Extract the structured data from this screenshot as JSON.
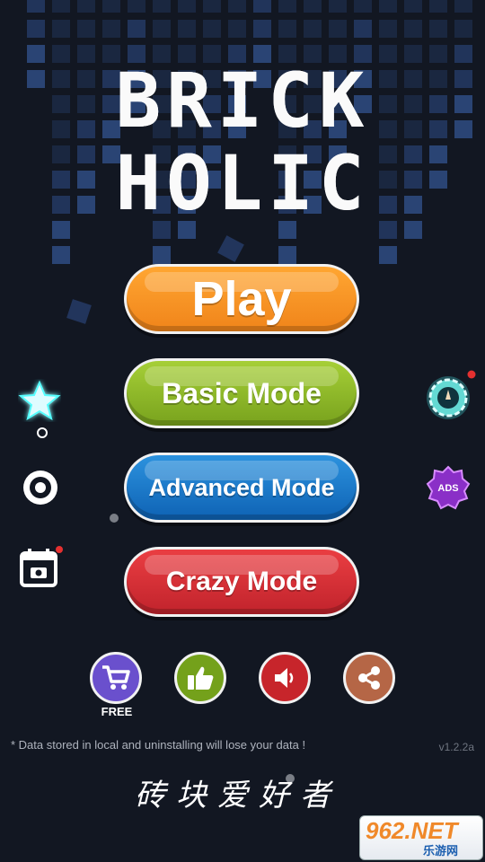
{
  "title": {
    "line1": "BRICK",
    "line2": "HOLIC"
  },
  "menu": {
    "play": "Play",
    "basic": "Basic Mode",
    "advanced": "Advanced Mode",
    "crazy": "Crazy Mode"
  },
  "side_icons": {
    "left": [
      "star-icon",
      "target-icon",
      "calendar-icon"
    ],
    "right": [
      "timer-gear-icon",
      "no-ads-icon"
    ],
    "no_ads_label": "ADS"
  },
  "bottom_buttons": {
    "shop_label": "FREE",
    "icons": [
      "cart-icon",
      "thumbs-up-icon",
      "speaker-icon",
      "share-icon"
    ]
  },
  "footer": {
    "notice": "* Data stored in local and uninstalling will lose your data !",
    "version": "v1.2.2a",
    "chinese_title": "砖块爱好者"
  },
  "watermark": {
    "main": "962.NET",
    "sub": "乐游网"
  },
  "colors": {
    "play": "#f0841a",
    "basic": "#8bb626",
    "advanced": "#1673c8",
    "crazy": "#cf2b33",
    "background": "#121722"
  }
}
